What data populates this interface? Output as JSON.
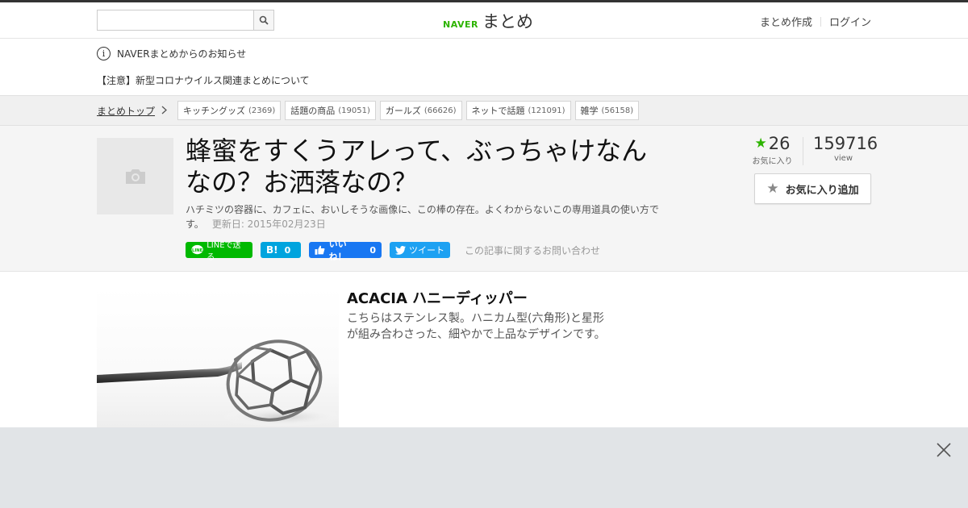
{
  "header": {
    "search_placeholder": "",
    "logo_brand": "NAVER",
    "logo_text": "まとめ",
    "nav": [
      "まとめ作成",
      "ログイン"
    ]
  },
  "notice": {
    "label": "NAVERまとめからのお知らせ",
    "link": "【注意】新型コロナウイルス関連まとめについて"
  },
  "categories": {
    "top_label": "まとめトップ",
    "items": [
      {
        "name": "キッチングッズ",
        "count": "(2369)"
      },
      {
        "name": "話題の商品",
        "count": "(19051)"
      },
      {
        "name": "ガールズ",
        "count": "(66626)"
      },
      {
        "name": "ネットで話題",
        "count": "(121091)"
      },
      {
        "name": "雑学",
        "count": "(56158)"
      }
    ]
  },
  "article": {
    "title": "蜂蜜をすくうアレって、ぶっちゃけなんなの？お洒落なの？",
    "description": "ハチミツの容器に、カフェに、おいしそうな画像に、この棒の存在。よくわからないこの専用道具の使い方です。",
    "updated": "更新日: 2015年02月23日",
    "favorites": "26",
    "favorites_label": "お気に入り",
    "views": "159716",
    "views_label": "view",
    "fav_button": "お気に入り追加"
  },
  "share": {
    "line": "LINEで送る",
    "hatena_count": "0",
    "fb_label": "いいね！",
    "fb_count": "0",
    "tweet": "ツイート",
    "inquiry": "この記事に関するお問い合わせ"
  },
  "item": {
    "title": "ACACIA ハニーディッパー",
    "description": "こちらはステンレス製。ハニカム型(六角形)と星形が組み合わさった、細やかで上品なデザインです。"
  },
  "colors": {
    "naver_green": "#2db400",
    "line_green": "#00b900",
    "hatena_blue": "#00a4de",
    "facebook_blue": "#1877f2",
    "twitter_blue": "#1da1f2"
  }
}
